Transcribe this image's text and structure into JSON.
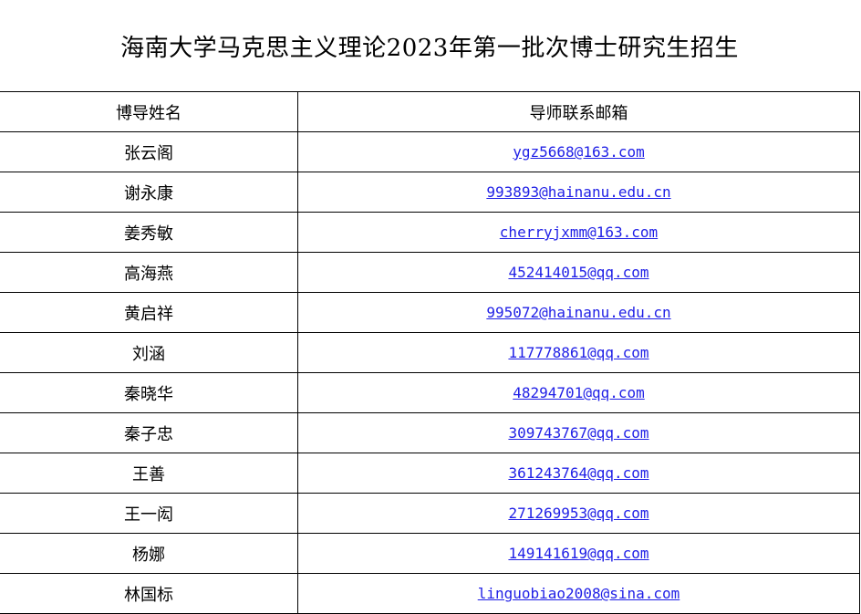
{
  "title": "海南大学马克思主义理论2023年第一批次博士研究生招生",
  "table": {
    "headers": {
      "name": "博导姓名",
      "email": "导师联系邮箱"
    },
    "rows": [
      {
        "name": "张云阁",
        "email": "ygz5668@163.com"
      },
      {
        "name": "谢永康",
        "email": "993893@hainanu.edu.cn"
      },
      {
        "name": "姜秀敏",
        "email": "cherryjxmm@163.com"
      },
      {
        "name": "高海燕",
        "email": "452414015@qq.com"
      },
      {
        "name": "黄启祥",
        "email": "995072@hainanu.edu.cn"
      },
      {
        "name": "刘涵",
        "email": "117778861@qq.com"
      },
      {
        "name": "秦晓华",
        "email": "48294701@qq.com"
      },
      {
        "name": "秦子忠",
        "email": "309743767@qq.com"
      },
      {
        "name": "王善",
        "email": "361243764@qq.com"
      },
      {
        "name": "王一闳",
        "email": "271269953@qq.com"
      },
      {
        "name": "杨娜",
        "email": "149141619@qq.com"
      },
      {
        "name": "林国标",
        "email": "linguobiao2008@sina.com"
      }
    ]
  },
  "colors": {
    "link": "#1f1fe6",
    "border": "#000000",
    "background": "#ffffff"
  }
}
